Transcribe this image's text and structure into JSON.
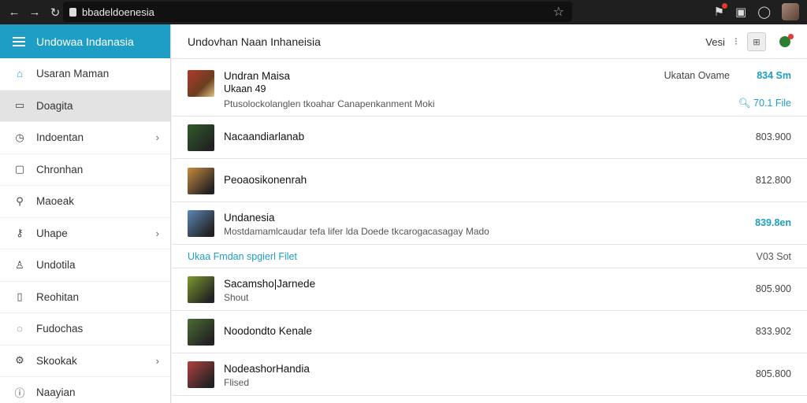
{
  "browser": {
    "url": "bbadeldoenesia",
    "icons": [
      "back-icon",
      "forward-icon",
      "reload-icon",
      "bookmark-star-icon",
      "extension-icon",
      "tab-icon",
      "profile-circle-icon"
    ]
  },
  "sidebar": {
    "title": "Undowaa Indanasia",
    "items": [
      {
        "label": "Usaran Maman",
        "icon": "home-icon",
        "chevron": false
      },
      {
        "label": "Doagita",
        "icon": "folder-icon",
        "chevron": false
      },
      {
        "label": "Indoentan",
        "icon": "clock-icon",
        "chevron": true
      },
      {
        "label": "Chronhan",
        "icon": "calendar-icon",
        "chevron": false
      },
      {
        "label": "Maoeak",
        "icon": "search-icon",
        "chevron": false
      },
      {
        "label": "Uhape",
        "icon": "key-icon",
        "chevron": true
      },
      {
        "label": "Undotila",
        "icon": "user-icon",
        "chevron": false
      },
      {
        "label": "Reohitan",
        "icon": "document-icon",
        "chevron": false
      },
      {
        "label": "Fudochas",
        "icon": "chat-icon",
        "chevron": false
      },
      {
        "label": "Skookak",
        "icon": "settings-icon",
        "chevron": true
      },
      {
        "label": "Naayian",
        "icon": "info-icon",
        "chevron": false
      }
    ]
  },
  "main": {
    "title": "Undovhan Naan Inhaneisia",
    "header_right_label": "Vesi",
    "header_more": "⁝",
    "featured": {
      "title": "Undran Maisa",
      "subtitle": "Ukaan 49",
      "description": "Ptusolockolanglen tkoahar Canapenkanment Moki",
      "meta_label": "Ukatan Ovame",
      "meta_value": "834 Sm",
      "file_link": "70.1 File"
    },
    "rows": [
      {
        "name": "Nacaandiarlanab",
        "sub": "",
        "value": "803.900",
        "accent": false,
        "color": "#2f5b2a"
      },
      {
        "name": "Peoaosikonenrah",
        "sub": "",
        "value": "812.800",
        "accent": false,
        "color": "#c98a3e"
      },
      {
        "name": "Undanesia",
        "sub": "Mostdamamlcaudar tefa lifer lda Doede tkcarogacasagay Mado",
        "value": "839.8en",
        "accent": true,
        "color": "#5d87b8"
      }
    ],
    "section": {
      "label": "Ukaa  Fmdan spgierl Filet",
      "value": "V03 Sot"
    },
    "rows2": [
      {
        "name": "Sacamsho|Jarnede",
        "sub": "Shout",
        "value": "805.900",
        "color": "#7c9a2e"
      },
      {
        "name": "Noodondto Kenale",
        "sub": "",
        "value": "833.902",
        "color": "#4a6d33"
      },
      {
        "name": "NodeashorHandia",
        "sub": "Flised",
        "value": "805.800",
        "color": "#b34040"
      }
    ]
  }
}
